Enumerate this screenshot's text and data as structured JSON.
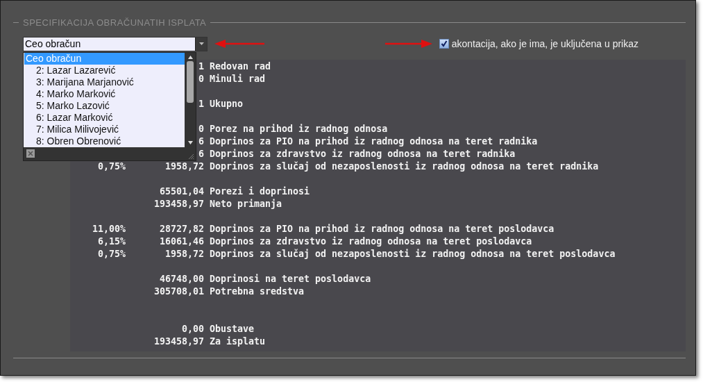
{
  "section": {
    "title": "SPECIFIKACIJA OBRAČUNATIH ISPLATA"
  },
  "dropdown": {
    "value": "Ceo obračun",
    "options": [
      {
        "label": "Ceo obračun",
        "selected": true
      },
      {
        "label": "2: Lazar Lazarević",
        "selected": false
      },
      {
        "label": "3: Marijana Marjanović",
        "selected": false
      },
      {
        "label": "4: Marko Marković",
        "selected": false
      },
      {
        "label": "5: Marko Lazović",
        "selected": false
      },
      {
        "label": "6: Lazar Marković",
        "selected": false
      },
      {
        "label": "7: Milica Milivojević",
        "selected": false
      },
      {
        "label": "8: Obren Obrenović",
        "selected": false
      }
    ]
  },
  "checkbox": {
    "label": "akontacija, ako je ima, je uključena u prikaz",
    "checked": true
  },
  "report": {
    "rows": [
      {
        "kind": "line",
        "amount": "1",
        "label": "Redovan rad"
      },
      {
        "kind": "line",
        "amount": "0",
        "label": "Minuli rad"
      },
      {
        "kind": "gap"
      },
      {
        "kind": "line",
        "amount": "1",
        "label": "Ukupno"
      },
      {
        "kind": "gap"
      },
      {
        "kind": "line",
        "amount": "0",
        "label": "Porez na prihod iz radnog odnosa"
      },
      {
        "kind": "line",
        "amount": "6",
        "label": "Doprinos za PIO na prihod iz radnog odnosa na teret radnika"
      },
      {
        "kind": "line",
        "amount": "6",
        "label": "Doprinos za zdravstvo iz radnog odnosa na teret radnika"
      },
      {
        "kind": "line",
        "percent": "0,75%",
        "amount": "1958,72",
        "label": "Doprinos za slučaj od nezaposlenosti iz radnog odnosa na teret radnika"
      },
      {
        "kind": "gap"
      },
      {
        "kind": "line",
        "amount": "65501,04",
        "label": "Porezi i doprinosi"
      },
      {
        "kind": "line",
        "amount": "193458,97",
        "label": "Neto primanja"
      },
      {
        "kind": "gap"
      },
      {
        "kind": "line",
        "percent": "11,00%",
        "amount": "28727,82",
        "label": "Doprinos za PIO na prihod iz radnog odnosa na teret poslodavca"
      },
      {
        "kind": "line",
        "percent": "6,15%",
        "amount": "16061,46",
        "label": "Doprinos za zdravstvo iz radnog odnosa na teret poslodavca"
      },
      {
        "kind": "line",
        "percent": "0,75%",
        "amount": "1958,72",
        "label": "Doprinos za slučaj od nezaposlenosti iz radnog odnosa na teret poslodavca"
      },
      {
        "kind": "gap"
      },
      {
        "kind": "line",
        "amount": "46748,00",
        "label": "Doprinosi na teret poslodavca"
      },
      {
        "kind": "line",
        "amount": "305708,01",
        "label": "Potrebna sredstva"
      },
      {
        "kind": "gap"
      },
      {
        "kind": "gap"
      },
      {
        "kind": "line",
        "amount": "0,00",
        "label": "Obustave"
      },
      {
        "kind": "line",
        "amount": "193458,97",
        "label": "Za isplatu"
      }
    ]
  }
}
